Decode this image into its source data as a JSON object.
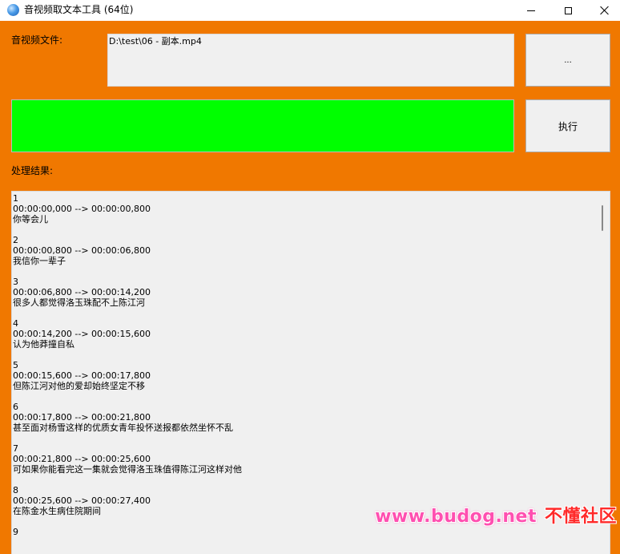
{
  "window": {
    "title": "音视频取文本工具 (64位)"
  },
  "form": {
    "file_label": "音视频文件:",
    "file_value": "D:\\test\\06 - 副本.mp4",
    "browse_label": "...",
    "execute_label": "执行",
    "progress_fraction": 1.0,
    "progress_color": "#00ff00",
    "result_label": "处理结果:"
  },
  "colors": {
    "background": "#f07800",
    "progress": "#00ff00"
  },
  "results": [
    {
      "index": "1",
      "time": "00:00:00,000 --> 00:00:00,800",
      "text": "你等会儿"
    },
    {
      "index": "2",
      "time": "00:00:00,800 --> 00:00:06,800",
      "text": "我信你一辈子"
    },
    {
      "index": "3",
      "time": "00:00:06,800 --> 00:00:14,200",
      "text": "很多人都觉得洛玉珠配不上陈江河"
    },
    {
      "index": "4",
      "time": "00:00:14,200 --> 00:00:15,600",
      "text": "认为他莽撞自私"
    },
    {
      "index": "5",
      "time": "00:00:15,600 --> 00:00:17,800",
      "text": "但陈江河对他的爱却始终坚定不移"
    },
    {
      "index": "6",
      "time": "00:00:17,800 --> 00:00:21,800",
      "text": "甚至面对杨雪这样的优质女青年投怀送报都依然坐怀不乱"
    },
    {
      "index": "7",
      "time": "00:00:21,800 --> 00:00:25,600",
      "text": "可如果你能看完这一集就会觉得洛玉珠值得陈江河这样对他"
    },
    {
      "index": "8",
      "time": "00:00:25,600 --> 00:00:27,400",
      "text": "在陈金水生病住院期间"
    },
    {
      "index": "9",
      "time": "",
      "text": ""
    }
  ],
  "watermark": {
    "url": "www.budog.net",
    "name": "不懂社区"
  }
}
